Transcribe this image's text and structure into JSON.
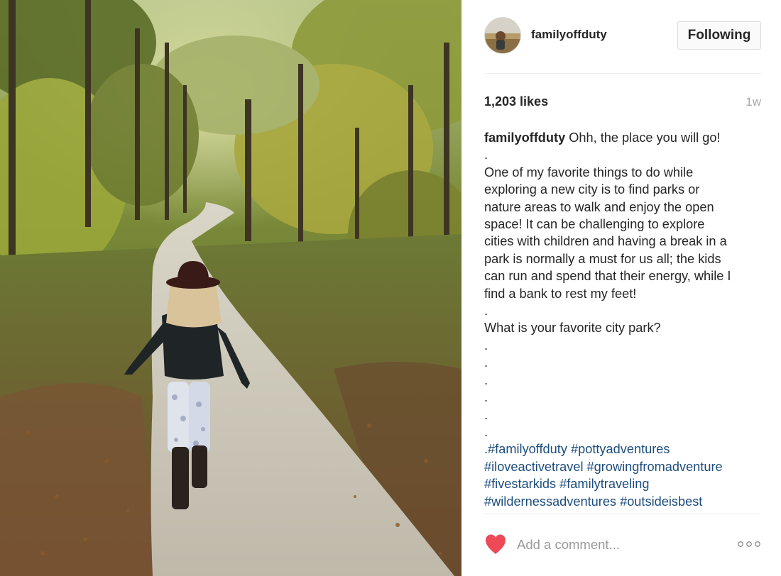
{
  "post": {
    "photo_alt": "",
    "author": {
      "username": "familyoffduty",
      "avatar_icon": "user-avatar"
    },
    "follow_button_label": "Following",
    "likes": "1,203 likes",
    "time_ago": "1w",
    "caption": {
      "author": "familyoffduty",
      "first_line_text": " Ohh, the place you will go!",
      "lines": [
        ".",
        "One of my favorite things to do while",
        "exploring a new city is to find parks or",
        "nature areas to walk and enjoy the open",
        "space! It can be challenging to explore",
        "cities with children and having a break in a",
        "park is normally a must for us all; the kids",
        "can run and spend that their energy, while I",
        "find a bank to rest my feet!",
        ".",
        "What is your favorite city park?",
        ".",
        ".",
        ".",
        ".",
        ".",
        "."
      ],
      "hashtag_lines": [
        ".#familyoffduty #pottyadventures",
        "#iloveactivetravel #growingfromadventure",
        "#fivestarkids #familytraveling",
        "#wildernessadventures #outsideisbest"
      ]
    }
  },
  "comment": {
    "placeholder": "Add a comment..."
  },
  "icons": {
    "like": "heart-icon",
    "options": "more-options-icon"
  },
  "colors": {
    "heart": "#ed4956",
    "hashtag": "#1d4d7e",
    "muted": "#a5a7aa",
    "border": "#dbdbdb"
  }
}
